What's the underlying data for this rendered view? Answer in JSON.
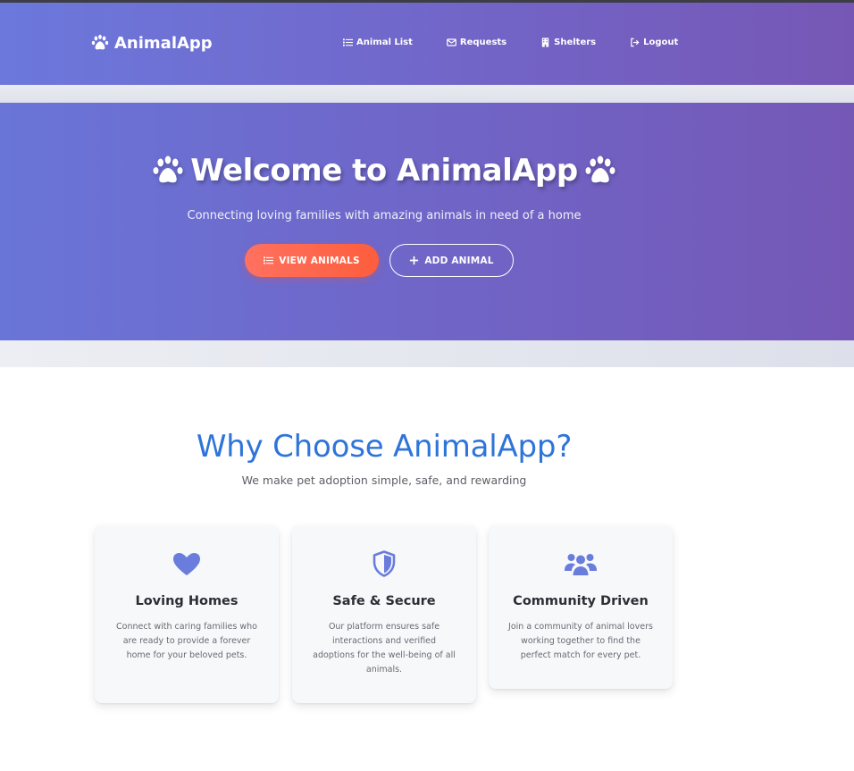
{
  "navbar": {
    "brand": "AnimalApp",
    "brand_icon": "paw-icon",
    "links": [
      {
        "label": "Animal List",
        "icon": "list-icon"
      },
      {
        "label": "Requests",
        "icon": "envelope-icon"
      },
      {
        "label": "Shelters",
        "icon": "building-icon"
      },
      {
        "label": "Logout",
        "icon": "logout-icon"
      }
    ]
  },
  "hero": {
    "title": "Welcome to AnimalApp",
    "subtitle": "Connecting loving families with amazing animals in need of a home",
    "buttons": {
      "primary": {
        "label": "VIEW ANIMALS",
        "icon": "list-icon"
      },
      "secondary": {
        "label": "ADD ANIMAL",
        "icon": "plus-icon"
      }
    }
  },
  "features": {
    "title": "Why Choose AnimalApp?",
    "subtitle": "We make pet adoption simple, safe, and rewarding",
    "cards": [
      {
        "title": "Loving Homes",
        "text": "Connect with caring families who are ready to provide a forever home for your beloved pets.",
        "icon": "heart-icon"
      },
      {
        "title": "Safe & Secure",
        "text": "Our platform ensures safe interactions and verified adoptions for the well-being of all animals.",
        "icon": "shield-icon"
      },
      {
        "title": "Community Driven",
        "text": "Join a community of animal lovers working together to find the perfect match for every pet.",
        "icon": "users-icon"
      }
    ]
  },
  "colors": {
    "nav_gradient_start": "#6c78dc",
    "nav_gradient_end": "#7657b5",
    "primary_button": "#fd5e3c",
    "features_title": "#2f74d9",
    "card_icon": "#6a7ddc"
  }
}
